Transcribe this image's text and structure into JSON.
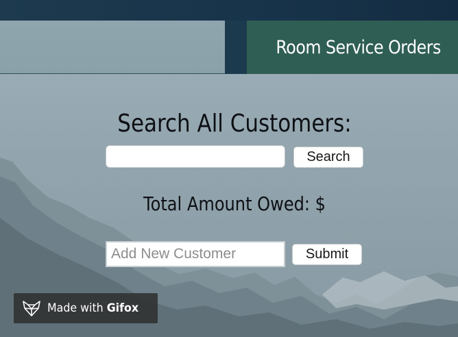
{
  "nav": {
    "room_service_tab": "Room Service Orders"
  },
  "search": {
    "heading": "Search All Customers:",
    "input_value": "",
    "button_label": "Search"
  },
  "summary": {
    "total_owed": "Total Amount Owed: $"
  },
  "add_customer": {
    "placeholder": "Add New Customer",
    "button_label": "Submit"
  },
  "watermark": {
    "prefix": "Made with",
    "brand": "Gifox"
  },
  "colors": {
    "active_tab": "#2f5e54",
    "top_bar": "#1b3a4d"
  },
  "icons": {
    "watermark_logo": "fox-icon"
  }
}
